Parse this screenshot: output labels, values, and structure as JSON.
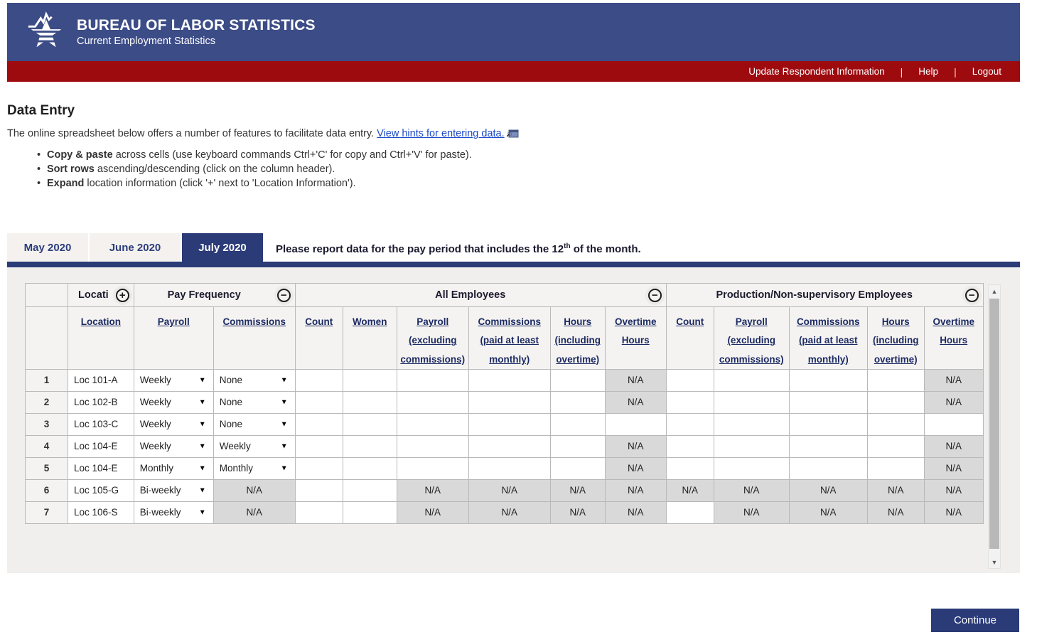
{
  "banner": {
    "title": "BUREAU OF LABOR STATISTICS",
    "subtitle": "Current Employment Statistics"
  },
  "nav": {
    "items": [
      "Update Respondent Information",
      "Help",
      "Logout"
    ]
  },
  "intro": {
    "heading": "Data Entry",
    "lead": "The online spreadsheet below offers a number of features to facilitate data entry. ",
    "link": "View hints for entering data.",
    "bullets": [
      {
        "bold": "Copy & paste",
        "rest": " across cells (use keyboard commands Ctrl+'C' for copy and Ctrl+'V' for paste)."
      },
      {
        "bold": "Sort rows",
        "rest": " ascending/descending (click on the column header)."
      },
      {
        "bold": "Expand",
        "rest": " location information (click '+' next to 'Location Information')."
      }
    ]
  },
  "tabs": {
    "items": [
      {
        "label": "May 2020",
        "active": false
      },
      {
        "label": "June 2020",
        "active": false
      },
      {
        "label": "July 2020",
        "active": true
      }
    ],
    "message_before": "Please report data for the pay period that includes the 12",
    "message_sup": "th",
    "message_after": " of the month."
  },
  "table": {
    "groups": {
      "location": "Locati",
      "pay_frequency": "Pay Frequency",
      "all_employees": "All Employees",
      "production": "Production/Non-supervisory Employees"
    },
    "subheaders": {
      "location": "Location",
      "payroll": "Payroll",
      "commissions": "Commissions",
      "count": "Count",
      "women": "Women",
      "payroll_l1": "Payroll",
      "payroll_l2": "(excluding",
      "payroll_l3": "commissions)",
      "commissions_l1": "Commissions",
      "commissions_l2": "(paid at least",
      "commissions_l3": "monthly)",
      "hours_l1": "Hours",
      "hours_l2": "(including",
      "hours_l3": "overtime)",
      "overtime_l1": "Overtime",
      "overtime_l2": "Hours"
    },
    "na_label": "N/A",
    "rows": [
      {
        "num": "1",
        "location": "Loc 101-A",
        "payroll_freq": "Weekly",
        "commissions_freq": "None",
        "commissions_freq_na": false,
        "all_employees": [
          "",
          "",
          "",
          "",
          "",
          "N/A"
        ],
        "production": [
          "",
          "",
          "",
          "",
          "N/A"
        ]
      },
      {
        "num": "2",
        "location": "Loc 102-B",
        "payroll_freq": "Weekly",
        "commissions_freq": "None",
        "commissions_freq_na": false,
        "all_employees": [
          "",
          "",
          "",
          "",
          "",
          "N/A"
        ],
        "production": [
          "",
          "",
          "",
          "",
          "N/A"
        ]
      },
      {
        "num": "3",
        "location": "Loc 103-C",
        "payroll_freq": "Weekly",
        "commissions_freq": "None",
        "commissions_freq_na": false,
        "all_employees": [
          "",
          "",
          "",
          "",
          "",
          ""
        ],
        "production": [
          "",
          "",
          "",
          "",
          ""
        ]
      },
      {
        "num": "4",
        "location": "Loc 104-E",
        "payroll_freq": "Weekly",
        "commissions_freq": "Weekly",
        "commissions_freq_na": false,
        "all_employees": [
          "",
          "",
          "",
          "",
          "",
          "N/A"
        ],
        "production": [
          "",
          "",
          "",
          "",
          "N/A"
        ]
      },
      {
        "num": "5",
        "location": "Loc 104-E",
        "payroll_freq": "Monthly",
        "commissions_freq": "Monthly",
        "commissions_freq_na": false,
        "all_employees": [
          "",
          "",
          "",
          "",
          "",
          "N/A"
        ],
        "production": [
          "",
          "",
          "",
          "",
          "N/A"
        ]
      },
      {
        "num": "6",
        "location": "Loc 105-G",
        "payroll_freq": "Bi-weekly",
        "commissions_freq": "",
        "commissions_freq_na": true,
        "all_employees": [
          "",
          "",
          "N/A",
          "N/A",
          "N/A",
          "N/A"
        ],
        "production": [
          "N/A",
          "N/A",
          "N/A",
          "N/A",
          "N/A"
        ]
      },
      {
        "num": "7",
        "location": "Loc 106-S",
        "payroll_freq": "Bi-weekly",
        "commissions_freq": "",
        "commissions_freq_na": true,
        "all_employees": [
          "",
          "",
          "N/A",
          "N/A",
          "N/A",
          "N/A"
        ],
        "production": [
          "",
          "N/A",
          "N/A",
          "N/A",
          "N/A"
        ]
      }
    ]
  },
  "footer": {
    "continue_label": "Continue"
  },
  "colors": {
    "banner_blue": "#3c4c87",
    "navy": "#2b3b78",
    "red": "#9e0b0f",
    "pipe_yellow": "#f2e3ad",
    "link_blue": "#1b49c8",
    "na_gray": "#d9d9d9",
    "header_bg": "#f5f3f1",
    "sheet_bg": "#f1efed"
  }
}
